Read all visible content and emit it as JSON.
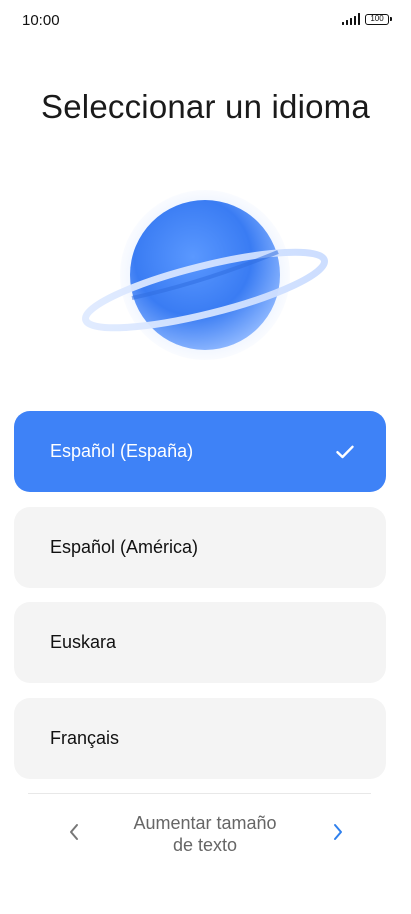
{
  "status_bar": {
    "time": "10:00",
    "battery_level": "100",
    "icons": [
      "signal-icon",
      "battery-icon"
    ]
  },
  "page": {
    "title": "Seleccionar un idioma"
  },
  "illustration": {
    "icon": "globe-planet-icon",
    "colors": {
      "planet": "#3d7ff3",
      "ring": "#cfe0ff"
    }
  },
  "languages": {
    "selected_index": 0,
    "items": [
      {
        "label": "Español (España)"
      },
      {
        "label": "Español (América)"
      },
      {
        "label": "Euskara"
      },
      {
        "label": "Français"
      }
    ]
  },
  "footer": {
    "back_icon": "chevron-left-icon",
    "next_icon": "chevron-right-icon",
    "text_size_line1": "Aumentar tamaño",
    "text_size_line2": "de texto"
  },
  "colors": {
    "accent": "#3e82f7",
    "option_background": "#f4f4f4",
    "next_arrow": "#2f80ed"
  }
}
